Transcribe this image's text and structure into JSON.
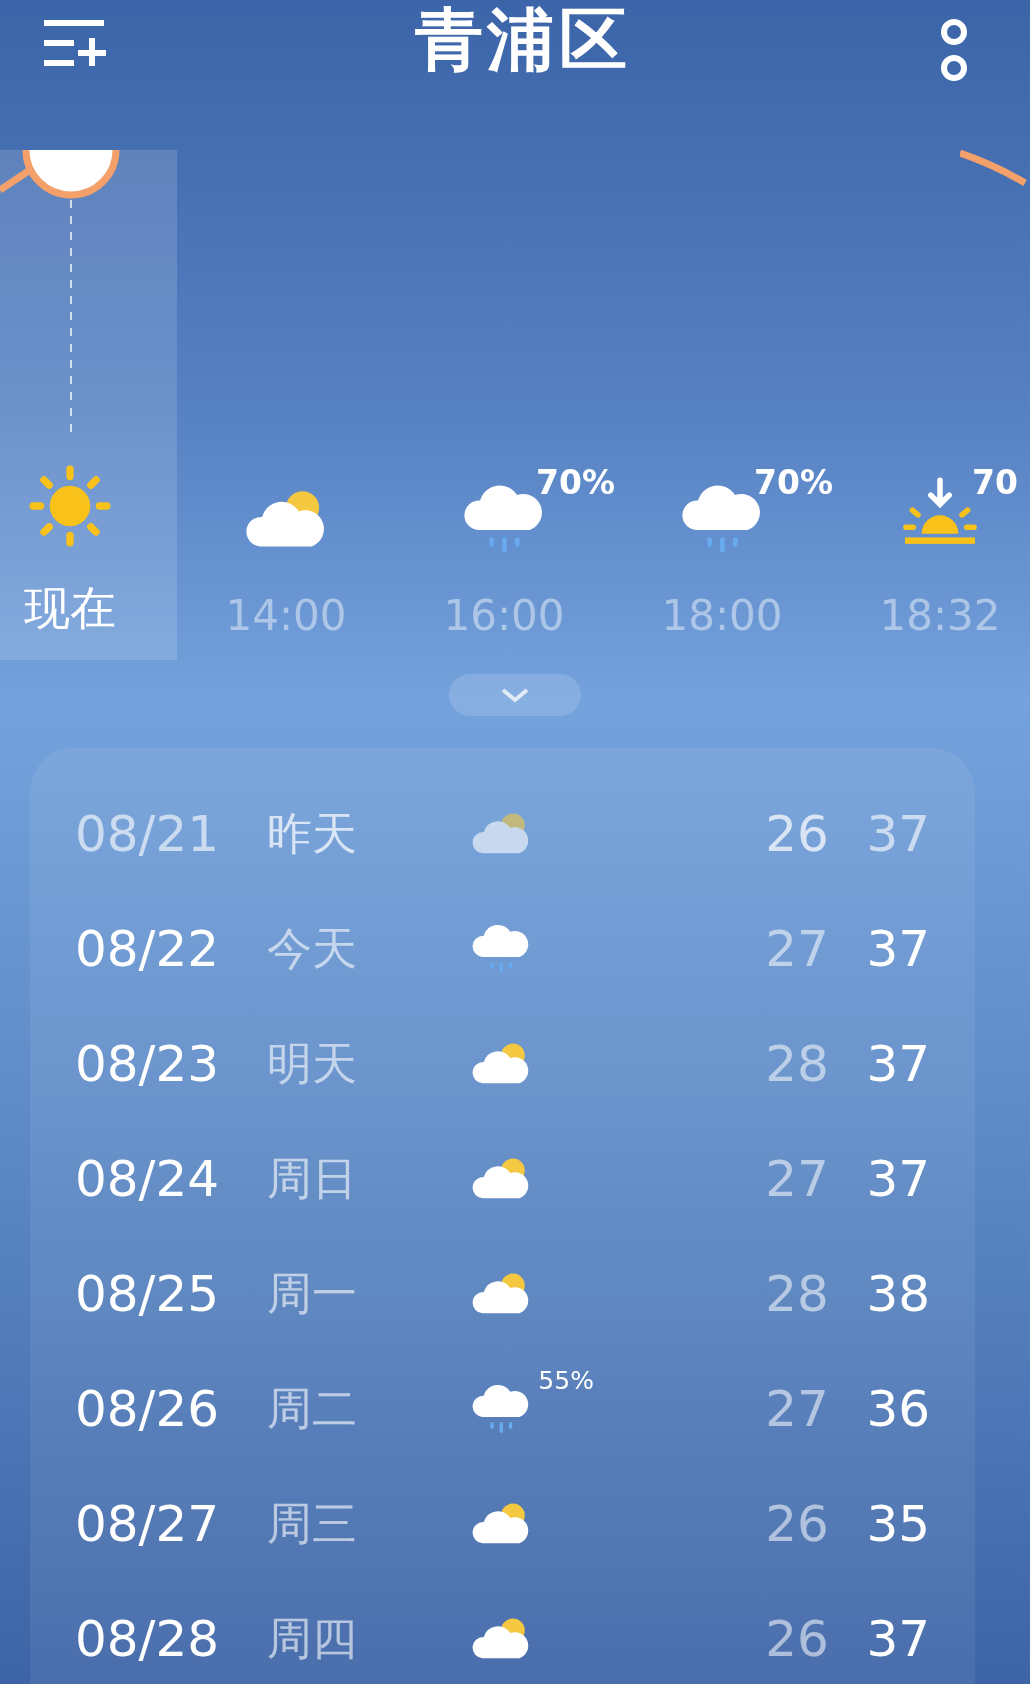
{
  "header": {
    "title": "青浦区"
  },
  "hourly": [
    {
      "kind": "sunny",
      "label": "现在",
      "selected": true
    },
    {
      "kind": "cloudy",
      "label": "14:00",
      "selected": false
    },
    {
      "kind": "rain",
      "label": "16:00",
      "precip": "70%",
      "selected": false
    },
    {
      "kind": "rain",
      "label": "18:00",
      "precip": "70%",
      "selected": false
    },
    {
      "kind": "sunset",
      "label": "18:32",
      "precip": "70",
      "selected": false
    }
  ],
  "daily": [
    {
      "date": "08/21",
      "day": "昨天",
      "kind": "cloudy",
      "low": "26",
      "high": "37",
      "past": true
    },
    {
      "date": "08/22",
      "day": "今天",
      "kind": "rain",
      "low": "27",
      "high": "37",
      "past": false
    },
    {
      "date": "08/23",
      "day": "明天",
      "kind": "cloudy",
      "low": "28",
      "high": "37",
      "past": false
    },
    {
      "date": "08/24",
      "day": "周日",
      "kind": "cloudy",
      "low": "27",
      "high": "37",
      "past": false
    },
    {
      "date": "08/25",
      "day": "周一",
      "kind": "cloudy",
      "low": "28",
      "high": "38",
      "past": false
    },
    {
      "date": "08/26",
      "day": "周二",
      "kind": "rain",
      "precip": "55%",
      "low": "27",
      "high": "36",
      "past": false
    },
    {
      "date": "08/27",
      "day": "周三",
      "kind": "cloudy",
      "low": "26",
      "high": "35",
      "past": false
    },
    {
      "date": "08/28",
      "day": "周四",
      "kind": "cloudy",
      "low": "26",
      "high": "37",
      "past": false
    }
  ]
}
